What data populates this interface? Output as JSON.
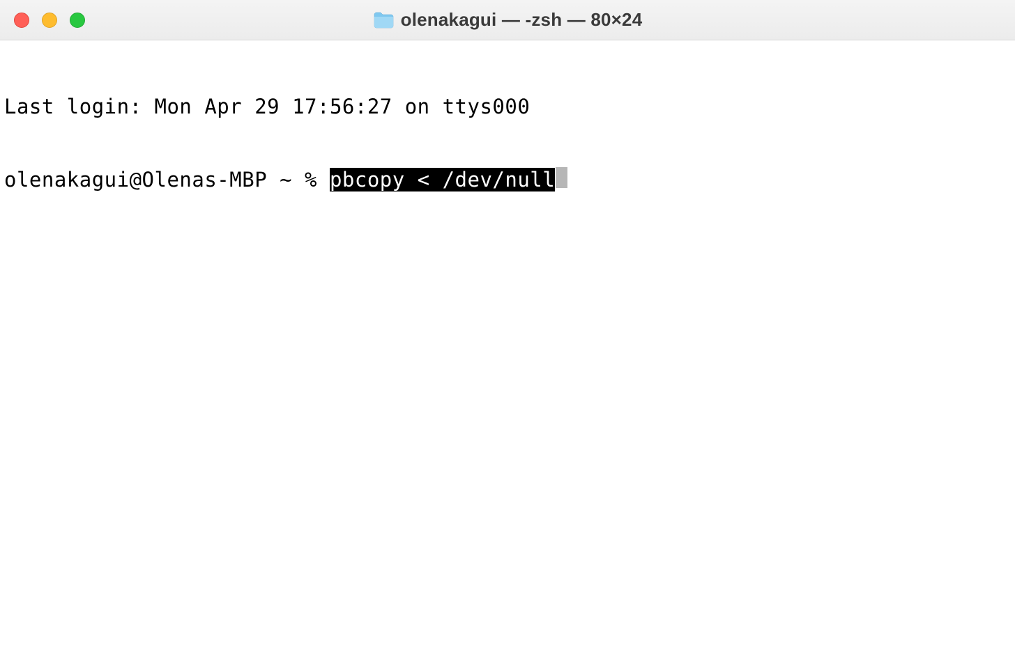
{
  "window": {
    "title": "olenakagui — -zsh — 80×24"
  },
  "terminal": {
    "last_login": "Last login: Mon Apr 29 17:56:27 on ttys000",
    "prompt": "olenakagui@Olenas-MBP ~ % ",
    "command": "pbcopy < /dev/null"
  }
}
